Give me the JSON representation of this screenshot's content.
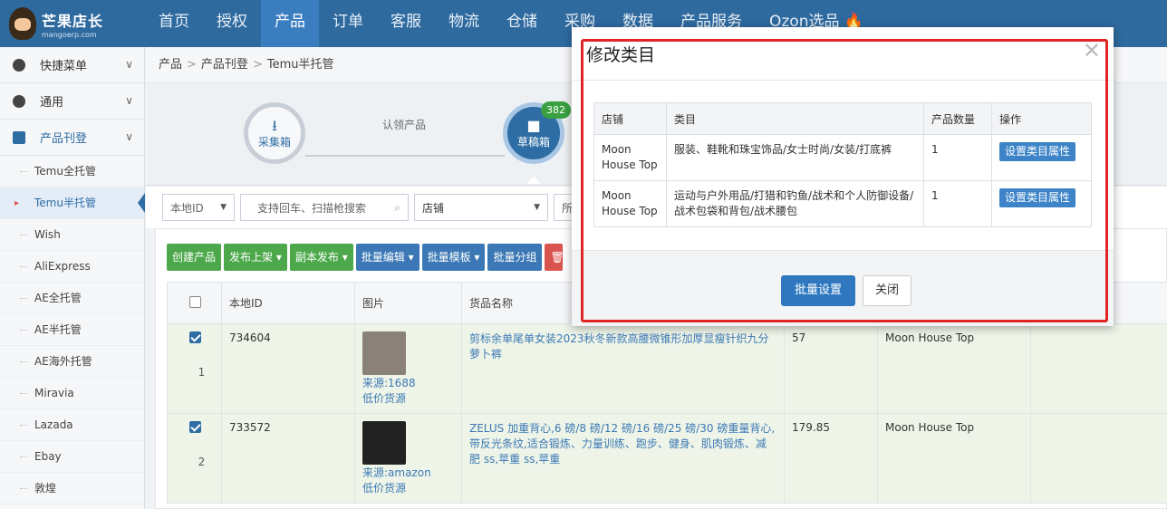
{
  "logo": {
    "title": "芒果店长",
    "subtitle": "mangoerp.com"
  },
  "nav": {
    "items": [
      "首页",
      "授权",
      "产品",
      "订单",
      "客服",
      "物流",
      "仓储",
      "采购",
      "数据",
      "产品服务",
      "Ozon选品"
    ],
    "active": "产品"
  },
  "sidebar": {
    "groups": [
      {
        "label": "快捷菜单",
        "icon": "gear-icon"
      },
      {
        "label": "通用",
        "icon": "gear-icon"
      },
      {
        "label": "产品刊登",
        "icon": "edit-icon"
      }
    ],
    "items": [
      "Temu全托管",
      "Temu半托管",
      "Wish",
      "AliExpress",
      "AE全托管",
      "AE半托管",
      "AE海外托管",
      "Miravia",
      "Lazada",
      "Ebay",
      "敦煌"
    ],
    "active_item": "Temu半托管"
  },
  "breadcrumb": [
    "产品",
    "产品刊登",
    "Temu半托管"
  ],
  "steps": {
    "collect_box": "采集箱",
    "claim_label": "认领产品",
    "draft_box": "草稿箱",
    "draft_count": "382"
  },
  "filters": {
    "local_id": "本地ID",
    "search_placeholder": "支持回车、扫描枪搜索",
    "shop": "店铺",
    "other": "所"
  },
  "toolbar": {
    "create": "创建产品",
    "publish": "发布上架",
    "copy_publish": "副本发布",
    "batch_edit": "批量编辑",
    "batch_template": "批量模板",
    "batch_group": "批量分组"
  },
  "grid": {
    "headers": [
      "本地ID",
      "图片",
      "货品名称"
    ],
    "rows": [
      {
        "num": "1",
        "id": "734604",
        "source": "来源:1688",
        "low_price": "低价货源",
        "name": "剪标余单尾单女装2023秋冬新款高腰微锥形加厚显瘦针织九分萝卜裤",
        "price": "57",
        "shop": "Moon House Top"
      },
      {
        "num": "2",
        "id": "733572",
        "source": "来源:amazon",
        "low_price": "低价货源",
        "name": "ZELUS 加重背心,6 磅/8 磅/12 磅/16 磅/25 磅/30 磅重量背心,带反光条纹,适合锻炼、力量训练、跑步、健身、肌肉锻炼、减肥 ss,苹重 ss,苹重",
        "price": "179.85",
        "shop": "Moon House Top"
      }
    ]
  },
  "modal": {
    "title": "修改类目",
    "headers": {
      "shop": "店铺",
      "category": "类目",
      "count": "产品数量",
      "action": "操作"
    },
    "rows": [
      {
        "shop": "Moon House Top",
        "category": "服装、鞋靴和珠宝饰品/女士时尚/女装/打底裤",
        "count": "1",
        "action": "设置类目属性"
      },
      {
        "shop": "Moon House Top",
        "category": "运动与户外用品/打猎和钓鱼/战术和个人防御设备/战术包袋和背包/战术腰包",
        "count": "1",
        "action": "设置类目属性"
      }
    ],
    "batch_set": "批量设置",
    "close": "关闭"
  }
}
